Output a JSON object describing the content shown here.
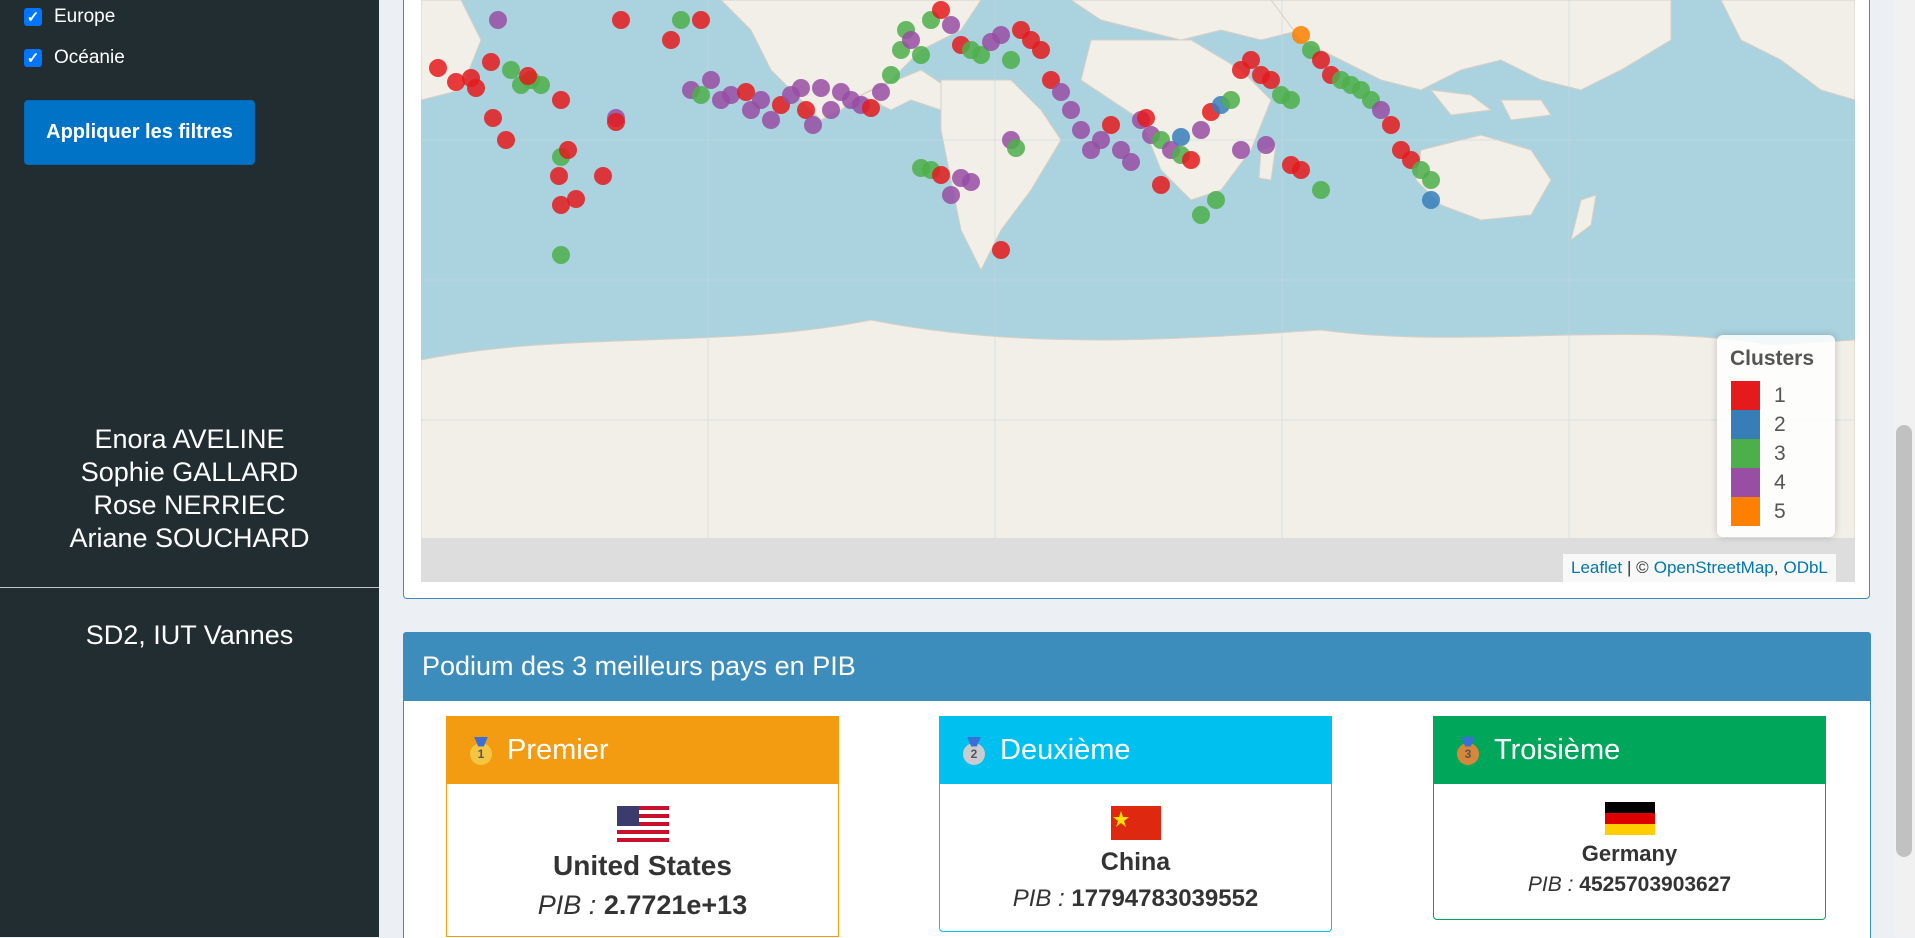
{
  "sidebar": {
    "filters": [
      {
        "label": "Europe",
        "checked": true
      },
      {
        "label": "Océanie",
        "checked": true
      }
    ],
    "apply_button": "Appliquer les filtres",
    "authors": [
      "Enora AVELINE",
      "Sophie GALLARD",
      "Rose NERRIEC",
      "Ariane SOUCHARD"
    ],
    "school": "SD2, IUT Vannes"
  },
  "map": {
    "legend": {
      "title": "Clusters",
      "items": [
        {
          "label": "1",
          "color": "#e41a1c"
        },
        {
          "label": "2",
          "color": "#377eb8"
        },
        {
          "label": "3",
          "color": "#4daf4a"
        },
        {
          "label": "4",
          "color": "#984ea3"
        },
        {
          "label": "5",
          "color": "#ff7f00"
        }
      ]
    },
    "attribution": {
      "leaflet": "Leaflet",
      "separator": "| ©",
      "osm": "OpenStreetMap",
      "comma": ",",
      "odbl": "ODbL"
    }
  },
  "podium": {
    "title": "Podium des 3 meilleurs pays en PIB",
    "pib_label": "PIB :",
    "cards": [
      {
        "rank": "Premier",
        "medal": "1",
        "country": "United States",
        "flag": "us-flag",
        "pib": "2.7721e+13",
        "color": "#f39c12"
      },
      {
        "rank": "Deuxième",
        "medal": "2",
        "country": "China",
        "flag": "cn-flag",
        "pib": "17794783039552",
        "color": "#00c0ef"
      },
      {
        "rank": "Troisième",
        "medal": "3",
        "country": "Germany",
        "flag": "de-flag",
        "pib": "4525703903627",
        "color": "#00a65a"
      }
    ]
  }
}
